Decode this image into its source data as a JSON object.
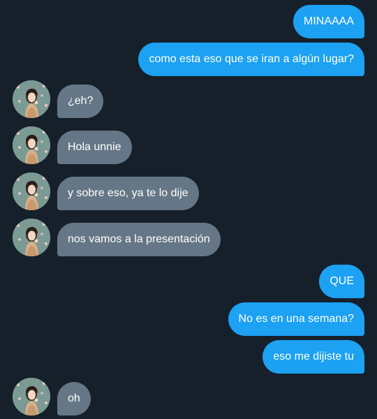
{
  "conversation": {
    "messages": [
      {
        "side": "sent",
        "text": "MINAAAA"
      },
      {
        "side": "sent",
        "text": "como esta eso que se iran a algún lugar?"
      },
      {
        "side": "received",
        "text": "¿eh?"
      },
      {
        "side": "received",
        "text": "Hola unnie"
      },
      {
        "side": "received",
        "text": "y sobre eso, ya te lo dije"
      },
      {
        "side": "received",
        "text": "nos vamos a la presentación"
      },
      {
        "side": "sent",
        "text": "QUE"
      },
      {
        "side": "sent",
        "text": "No es en una semana?"
      },
      {
        "side": "sent",
        "text": "eso me dijiste tu"
      },
      {
        "side": "received",
        "text": "oh"
      }
    ]
  },
  "colors": {
    "background": "#15202b",
    "sent_bubble": "#1da1f2",
    "received_bubble": "#657786",
    "text": "#ffffff"
  },
  "icons": {
    "avatar": "contact-avatar-photo"
  }
}
